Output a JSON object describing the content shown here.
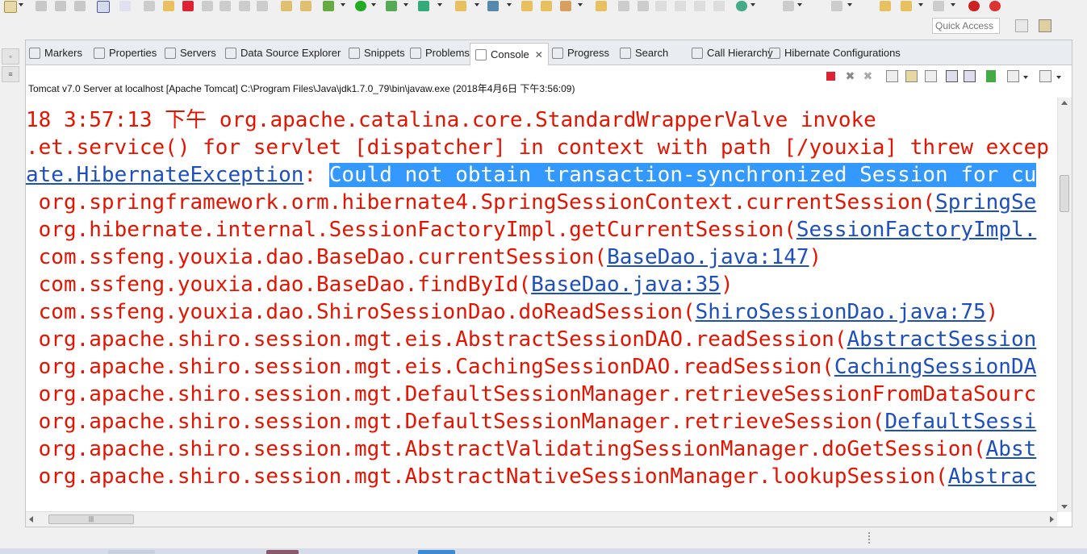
{
  "quick_access": {
    "placeholder": "Quick Access"
  },
  "tabs": [
    {
      "label": "Markers",
      "icon": "markers-icon"
    },
    {
      "label": "Properties",
      "icon": "properties-icon"
    },
    {
      "label": "Servers",
      "icon": "servers-icon"
    },
    {
      "label": "Data Source Explorer",
      "icon": "data-source-explorer-icon"
    },
    {
      "label": "Snippets",
      "icon": "snippets-icon"
    },
    {
      "label": "Problems",
      "icon": "problems-icon"
    },
    {
      "label": "Console",
      "icon": "console-icon",
      "active": true,
      "close": "✕"
    },
    {
      "label": "Progress",
      "icon": "progress-icon"
    },
    {
      "label": "Search",
      "icon": "search-icon"
    },
    {
      "label": "Call Hierarchy",
      "icon": "call-hierarchy-icon"
    },
    {
      "label": "Hibernate Configurations",
      "icon": "hibernate-configurations-icon"
    }
  ],
  "console": {
    "process_label": "Tomcat v7.0 Server at localhost [Apache Tomcat] C:\\Program Files\\Java\\jdk1.7.0_79\\bin\\javaw.exe (2018年4月6日 下午3:56:09)",
    "lines": [
      {
        "parts": [
          {
            "text": "18 3:57:13 下午 org.apache.catalina.core.StandardWrapperValve invoke",
            "style": "text"
          }
        ]
      },
      {
        "parts": [
          {
            "text": ".et.service() for servlet [dispatcher] in context with path [/youxia] threw excep",
            "style": "text"
          }
        ]
      },
      {
        "parts": [
          {
            "text": "ate.HibernateException",
            "style": "link"
          },
          {
            "text": ": ",
            "style": "text"
          },
          {
            "text": "Could not obtain transaction-synchronized Session for cu",
            "style": "sel"
          }
        ]
      },
      {
        "parts": [
          {
            "text": " org.springframework.orm.hibernate4.SpringSessionContext.currentSession(",
            "style": "text"
          },
          {
            "text": "SpringSe",
            "style": "link"
          }
        ]
      },
      {
        "parts": [
          {
            "text": " org.hibernate.internal.SessionFactoryImpl.getCurrentSession(",
            "style": "text"
          },
          {
            "text": "SessionFactoryImpl.",
            "style": "link"
          }
        ]
      },
      {
        "parts": [
          {
            "text": " com.ssfeng.youxia.dao.BaseDao.currentSession(",
            "style": "text"
          },
          {
            "text": "BaseDao.java:147",
            "style": "link"
          },
          {
            "text": ")",
            "style": "text"
          }
        ]
      },
      {
        "parts": [
          {
            "text": " com.ssfeng.youxia.dao.BaseDao.findById(",
            "style": "text"
          },
          {
            "text": "BaseDao.java:35",
            "style": "link"
          },
          {
            "text": ")",
            "style": "text"
          }
        ]
      },
      {
        "parts": [
          {
            "text": " com.ssfeng.youxia.dao.ShiroSessionDao.doReadSession(",
            "style": "text"
          },
          {
            "text": "ShiroSessionDao.java:75",
            "style": "link"
          },
          {
            "text": ")",
            "style": "text"
          }
        ]
      },
      {
        "parts": [
          {
            "text": " org.apache.shiro.session.mgt.eis.AbstractSessionDAO.readSession(",
            "style": "text"
          },
          {
            "text": "AbstractSession",
            "style": "link"
          }
        ]
      },
      {
        "parts": [
          {
            "text": " org.apache.shiro.session.mgt.eis.CachingSessionDAO.readSession(",
            "style": "text"
          },
          {
            "text": "CachingSessionDA",
            "style": "link"
          }
        ]
      },
      {
        "parts": [
          {
            "text": " org.apache.shiro.session.mgt.DefaultSessionManager.retrieveSessionFromDataSourc",
            "style": "text"
          }
        ]
      },
      {
        "parts": [
          {
            "text": " org.apache.shiro.session.mgt.DefaultSessionManager.retrieveSession(",
            "style": "text"
          },
          {
            "text": "DefaultSessi",
            "style": "link"
          }
        ]
      },
      {
        "parts": [
          {
            "text": " org.apache.shiro.session.mgt.AbstractValidatingSessionManager.doGetSession(",
            "style": "text"
          },
          {
            "text": "Abst",
            "style": "link"
          }
        ]
      },
      {
        "parts": [
          {
            "text": " org.apache.shiro.session.mgt.AbstractNativeSessionManager.lookupSession(",
            "style": "text"
          },
          {
            "text": "Abstrac",
            "style": "link"
          }
        ]
      }
    ]
  },
  "scrollbar": {
    "grip": "|||"
  },
  "colors": {
    "error_text": "#e51400",
    "link": "#1d4fbf",
    "selection": "#3399ff"
  }
}
